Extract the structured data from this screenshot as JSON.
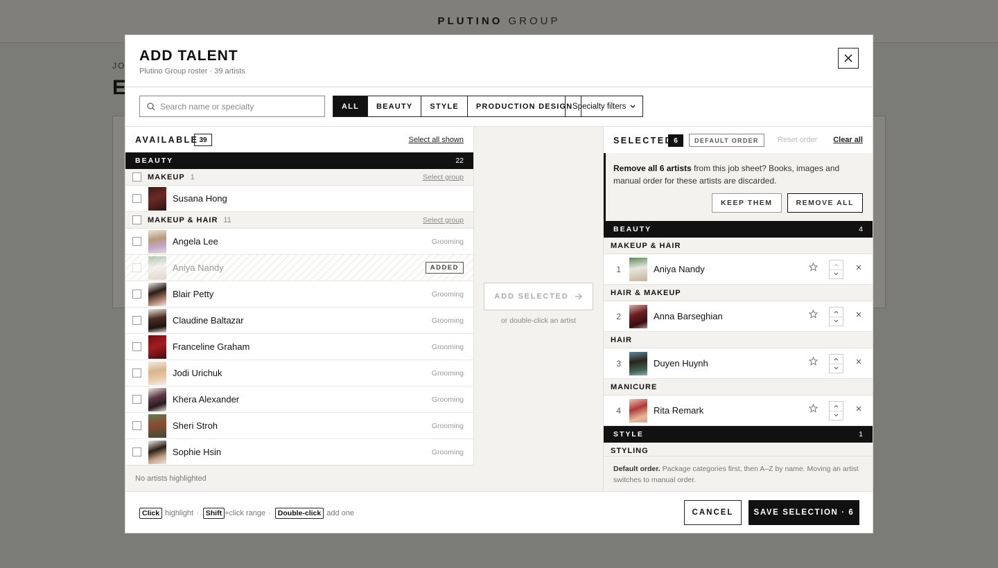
{
  "background": {
    "brand_bold": "PLUTINO",
    "brand_light": "GROUP",
    "crumb": "JO",
    "title": "E"
  },
  "modal": {
    "title": "ADD TALENT",
    "subtitle": "Plutino Group roster · 39 artists"
  },
  "toolbar": {
    "search_placeholder": "Search name or specialty",
    "search_value": "",
    "segments": [
      "ALL",
      "BEAUTY",
      "STYLE",
      "PRODUCTION DESIGN"
    ],
    "active_segment": "ALL",
    "specialty_label": "Specialty filters"
  },
  "available": {
    "title": "AVAILABLE",
    "count": "39",
    "select_all": "Select all shown",
    "section": {
      "name": "BEAUTY",
      "count": "22"
    },
    "groups": [
      {
        "name": "MAKEUP",
        "count": "1",
        "select": "Select group",
        "artists": [
          {
            "name": "Susana Hong",
            "specialty": ""
          }
        ]
      },
      {
        "name": "MAKEUP & HAIR",
        "count": "11",
        "select": "Select group",
        "artists": [
          {
            "name": "Angela Lee",
            "specialty": "Grooming"
          },
          {
            "name": "Aniya Nandy",
            "specialty": "",
            "added": "ADDED"
          },
          {
            "name": "Blair Petty",
            "specialty": "Grooming"
          },
          {
            "name": "Claudine Baltazar",
            "specialty": "Grooming"
          },
          {
            "name": "Franceline Graham",
            "specialty": "Grooming"
          },
          {
            "name": "Jodi Urichuk",
            "specialty": "Grooming"
          },
          {
            "name": "Khera Alexander",
            "specialty": "Grooming"
          },
          {
            "name": "Sheri Stroh",
            "specialty": "Grooming"
          },
          {
            "name": "Sophie Hsin",
            "specialty": "Grooming"
          }
        ]
      }
    ],
    "footer": "No artists highlighted"
  },
  "middle": {
    "add_label": "ADD SELECTED",
    "note": "or double-click an artist"
  },
  "selected": {
    "title": "SELECTED",
    "count": "6",
    "order_badge": "DEFAULT ORDER",
    "reset": "Reset order",
    "clear": "Clear all",
    "confirm": {
      "bold": "Remove all 6 artists",
      "text": " from this job sheet? Books, images and manual order for these artists are discarded.",
      "keep": "KEEP THEM",
      "remove": "REMOVE ALL"
    },
    "sections": [
      {
        "name": "BEAUTY",
        "count": "4"
      },
      {
        "name": "STYLE",
        "count": "1"
      }
    ],
    "groups": [
      {
        "name": "MAKEUP & HAIR",
        "artist": {
          "num": "1",
          "name": "Aniya Nandy"
        }
      },
      {
        "name": "HAIR & MAKEUP",
        "artist": {
          "num": "2",
          "name": "Anna Barseghian"
        }
      },
      {
        "name": "HAIR",
        "artist": {
          "num": "3",
          "name": "Duyen Huynh"
        }
      },
      {
        "name": "MANICURE",
        "artist": {
          "num": "4",
          "name": "Rita Remark"
        }
      },
      {
        "name": "STYLING"
      }
    ],
    "footer_bold": "Default order.",
    "footer_text": " Package categories first, then A–Z by name. Moving an artist switches to manual order."
  },
  "footer": {
    "hint1_key": "Click",
    "hint1_text": "highlight",
    "hint2_key": "Shift",
    "hint2_text": "+click range",
    "hint3_key": "Double-click",
    "hint3_text": "add one",
    "cancel": "CANCEL",
    "save": "SAVE SELECTION · 6"
  },
  "colors": {
    "accent": "#111111",
    "panel": "#f3f2ef",
    "overlay": "#7b7b78"
  },
  "icons": {
    "close": "close-icon",
    "search": "search-icon",
    "chevron": "chevron-down-icon",
    "arrow": "arrow-right-icon",
    "star": "star-icon",
    "remove": "remove-icon"
  }
}
